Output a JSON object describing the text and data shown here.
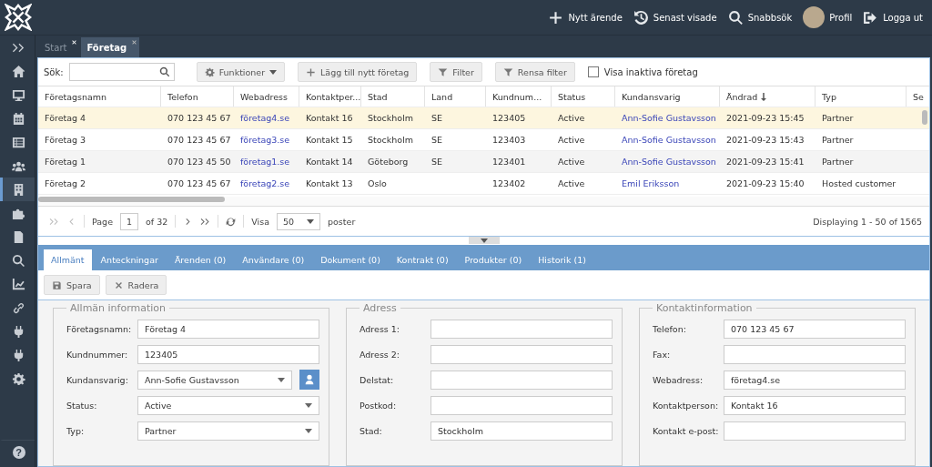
{
  "header": {
    "actions": [
      {
        "kind": "plus",
        "label": "Nytt ärende"
      },
      {
        "kind": "history",
        "label": "Senast visade"
      },
      {
        "kind": "search",
        "label": "Snabbsök"
      },
      {
        "kind": "avatar",
        "label": "Profil"
      },
      {
        "kind": "logout",
        "label": "Logga ut"
      }
    ]
  },
  "sidebar": {
    "items": [
      {
        "kind": "expand",
        "selected": false
      },
      {
        "kind": "home",
        "selected": false
      },
      {
        "kind": "monitor",
        "selected": false
      },
      {
        "kind": "calendar",
        "selected": false
      },
      {
        "kind": "list",
        "selected": false
      },
      {
        "kind": "users",
        "selected": false
      },
      {
        "kind": "building",
        "selected": true
      },
      {
        "kind": "puzzle",
        "selected": false
      },
      {
        "kind": "document",
        "selected": false
      },
      {
        "kind": "search",
        "selected": false
      },
      {
        "kind": "chart",
        "selected": false
      },
      {
        "kind": "link",
        "selected": false
      },
      {
        "kind": "plug",
        "selected": false
      },
      {
        "kind": "plug",
        "selected": false
      },
      {
        "kind": "gear",
        "selected": false
      }
    ],
    "help": "?"
  },
  "tabs": [
    {
      "label": "Start",
      "selected": false
    },
    {
      "label": "Företag",
      "selected": true
    }
  ],
  "toolbar": {
    "search_label": "Sök:",
    "buttons": [
      {
        "kind": "gear",
        "label": "Funktioner",
        "dropdown": true
      },
      {
        "kind": "plus",
        "label": "Lägg till nytt företag",
        "dropdown": false
      },
      {
        "kind": "filter",
        "label": "Filter",
        "dropdown": false
      },
      {
        "kind": "filter",
        "label": "Rensa filter",
        "dropdown": false
      }
    ],
    "checkbox": {
      "label": "Visa inaktiva företag",
      "checked": false
    }
  },
  "table": {
    "columns": [
      {
        "label": "Företagsnamn",
        "kind": "text"
      },
      {
        "label": "Telefon",
        "kind": "text"
      },
      {
        "label": "Webadress",
        "kind": "link"
      },
      {
        "label": "Kontaktper...",
        "kind": "text"
      },
      {
        "label": "Stad",
        "kind": "text"
      },
      {
        "label": "Land",
        "kind": "text"
      },
      {
        "label": "Kundnum...",
        "kind": "text"
      },
      {
        "label": "Status",
        "kind": "text"
      },
      {
        "label": "Kundansvarig",
        "kind": "link"
      },
      {
        "label": "Ändrad",
        "kind": "text",
        "sorted_descending": true
      },
      {
        "label": "Typ",
        "kind": "text"
      },
      {
        "label": "Se"
      }
    ],
    "rows": [
      {
        "selected": true,
        "cells": [
          "Företag 4",
          "070 123 45 67",
          "företag4.se",
          "Kontakt 16",
          "Stockholm",
          "SE",
          "123405",
          "Active",
          "Ann-Sofie Gustavsson",
          "2021-09-23 15:45",
          "Partner"
        ]
      },
      {
        "selected": false,
        "cells": [
          "Företag 3",
          "070 123 45 67",
          "företag3.se",
          "Kontakt 15",
          "Stockholm",
          "SE",
          "123403",
          "Active",
          "Ann-Sofie Gustavsson",
          "2021-09-23 15:43",
          "Partner"
        ]
      },
      {
        "selected": false,
        "cells": [
          "Företag 1",
          "070 123 45 50",
          "företag1.se",
          "Kontakt 14",
          "Göteborg",
          "SE",
          "123401",
          "Active",
          "Ann-Sofie Gustavsson",
          "2021-09-23 15:41",
          "Partner"
        ]
      },
      {
        "selected": false,
        "cells": [
          "Företag 2",
          "070 123 45 67",
          "företag2.se",
          "Kontakt 13",
          "Oslo",
          null,
          "123402",
          "Active",
          "Emil Eriksson",
          "2021-09-23 15:40",
          "Hosted customer"
        ]
      }
    ]
  },
  "pager": {
    "page_label": "Page",
    "page": "1",
    "of": "of 32",
    "show_label": "Visa",
    "per_page": "50",
    "per_page_suffix": "poster",
    "displaying": "Displaying 1 - 50 of 1565"
  },
  "detail_tabs": [
    {
      "label": "Allmänt",
      "selected": true
    },
    {
      "label": "Anteckningar",
      "selected": false
    },
    {
      "label": "Ärenden (0)",
      "selected": false
    },
    {
      "label": "Användare (0)",
      "selected": false
    },
    {
      "label": "Dokument (0)",
      "selected": false
    },
    {
      "label": "Kontrakt (0)",
      "selected": false
    },
    {
      "label": "Produkter (0)",
      "selected": false
    },
    {
      "label": "Historik (1)",
      "selected": false
    }
  ],
  "detail_buttons": [
    {
      "kind": "save",
      "label": "Spara"
    },
    {
      "kind": "delete",
      "label": "Radera"
    }
  ],
  "sections": [
    {
      "title": "Allmän information",
      "fields": [
        {
          "label": "Företagsnamn:",
          "value": "Företag 4",
          "kind": "text",
          "user_button": false
        },
        {
          "label": "Kundnummer:",
          "value": "123405",
          "kind": "text",
          "user_button": false
        },
        {
          "label": "Kundansvarig:",
          "value": "Ann-Sofie Gustavsson",
          "kind": "select",
          "user_button": true
        },
        {
          "label": "Status:",
          "value": "Active",
          "kind": "select",
          "user_button": false
        },
        {
          "label": "Typ:",
          "value": "Partner",
          "kind": "select",
          "user_button": false
        }
      ]
    },
    {
      "title": "Adress",
      "fields": [
        {
          "label": "Adress 1:",
          "kind": "text",
          "user_button": false
        },
        {
          "label": "Adress 2:",
          "kind": "text",
          "user_button": false
        },
        {
          "label": "Delstat:",
          "kind": "text",
          "user_button": false
        },
        {
          "label": "Postkod:",
          "kind": "text",
          "user_button": false
        },
        {
          "label": "Stad:",
          "value": "Stockholm",
          "kind": "text",
          "user_button": false
        }
      ]
    },
    {
      "title": "Kontaktinformation",
      "fields": [
        {
          "label": "Telefon:",
          "value": "070 123 45 67",
          "kind": "text",
          "user_button": false
        },
        {
          "label": "Fax:",
          "kind": "text",
          "user_button": false
        },
        {
          "label": "Webadress:",
          "value": "företag4.se",
          "kind": "text",
          "user_button": false
        },
        {
          "label": "Kontaktperson:",
          "value": "Kontakt 16",
          "kind": "text",
          "user_button": false
        },
        {
          "label": "Kontakt e-post:",
          "kind": "text",
          "user_button": false
        }
      ]
    }
  ]
}
